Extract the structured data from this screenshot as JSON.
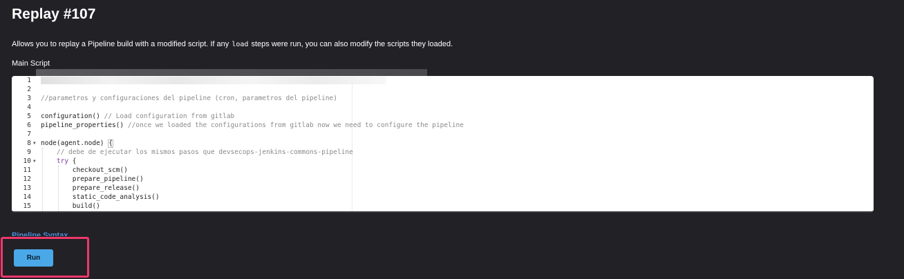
{
  "page": {
    "title": "Replay #107",
    "description_before": "Allows you to replay a Pipeline build with a modified script. If any ",
    "description_code": "load",
    "description_after": " steps were run, you can also modify the scripts they loaded.",
    "main_script_label": "Main Script",
    "pipeline_syntax_link": "Pipeline Syntax",
    "run_button": "Run"
  },
  "editor": {
    "lines": [
      {
        "num": "1",
        "text": ""
      },
      {
        "num": "2",
        "text": ""
      },
      {
        "num": "3",
        "text": "//parametros y configuraciones del pipeline (cron, parametros del pipeline)"
      },
      {
        "num": "4",
        "text": ""
      },
      {
        "num": "5",
        "code": "configuration() ",
        "comment": "// Load configuration from gitlab"
      },
      {
        "num": "6",
        "code": "pipeline_properties() ",
        "comment": "//once we loaded the configurations from gitlab now we need to configure the pipeline"
      },
      {
        "num": "7",
        "text": ""
      },
      {
        "num": "8",
        "code": "node(agent.node) ",
        "bracket": "{"
      },
      {
        "num": "9",
        "text": "    // debe de ejecutar los mismos pasos que devsecops-jenkins-commons-pipeline"
      },
      {
        "num": "10",
        "kw": "try",
        "code": " {"
      },
      {
        "num": "11",
        "text": "        checkout_scm()"
      },
      {
        "num": "12",
        "text": "        prepare_pipeline()"
      },
      {
        "num": "13",
        "text": "        prepare_release()"
      },
      {
        "num": "14",
        "text": "        static_code_analysis()"
      },
      {
        "num": "15",
        "text": "        build()"
      }
    ]
  },
  "colors": {
    "background": "#222126",
    "link": "#4a90d9",
    "run_button": "#4aa8e8",
    "highlight_border": "#f0386b"
  },
  "icons": {
    "fold_marker": "triangle-down-icon"
  }
}
